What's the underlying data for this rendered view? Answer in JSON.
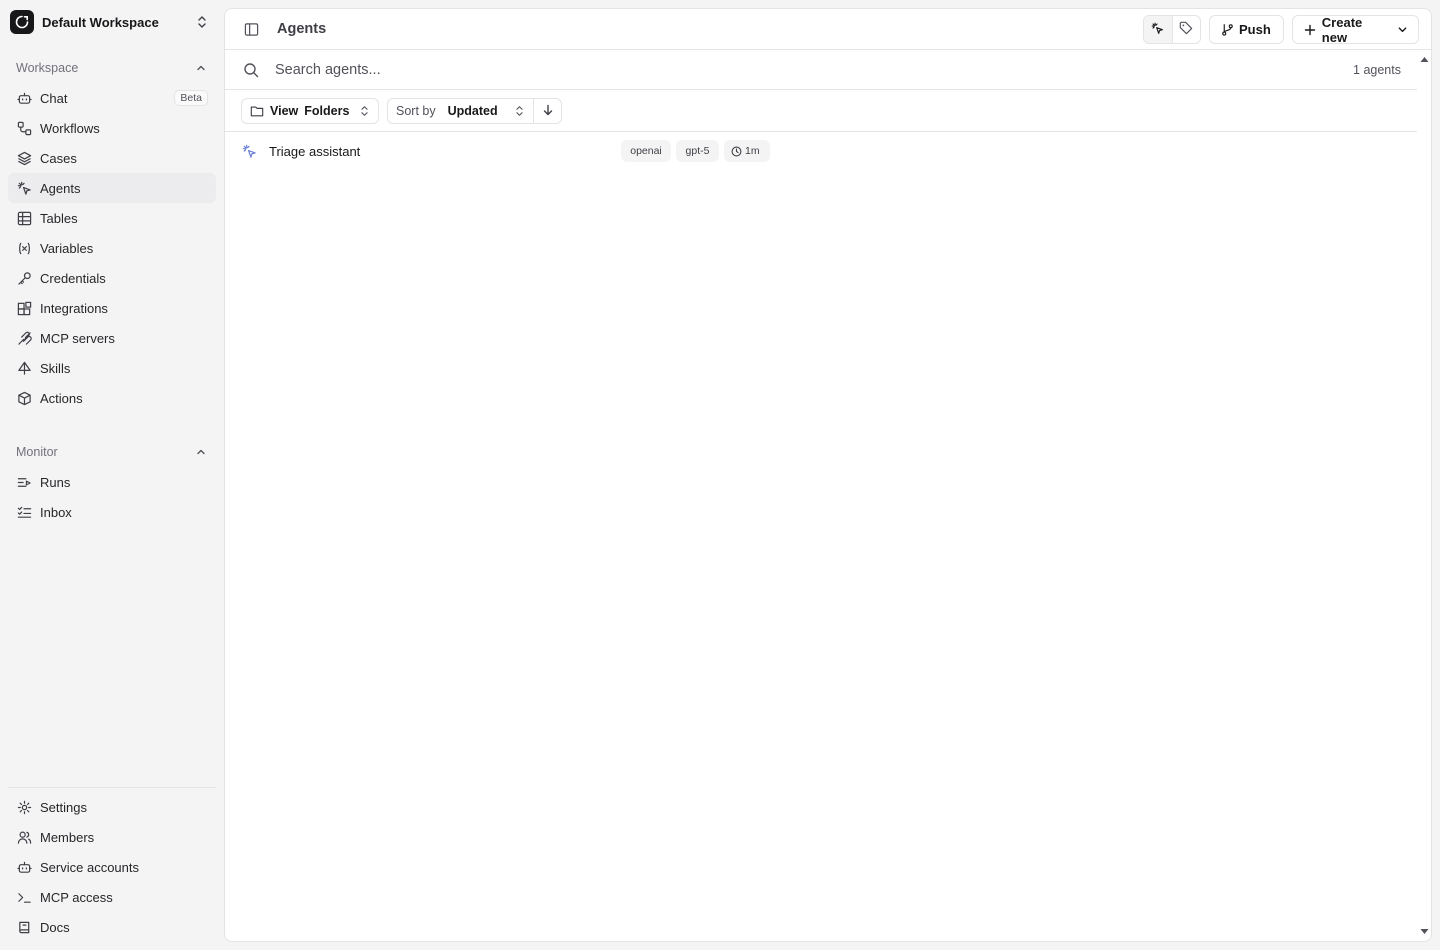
{
  "workspace": {
    "name": "Default Workspace"
  },
  "sidebar": {
    "workspace_section": {
      "label": "Workspace"
    },
    "workspace_items": [
      {
        "label": "Chat",
        "badge": "Beta"
      },
      {
        "label": "Workflows"
      },
      {
        "label": "Cases"
      },
      {
        "label": "Agents",
        "active": true
      },
      {
        "label": "Tables"
      },
      {
        "label": "Variables"
      },
      {
        "label": "Credentials"
      },
      {
        "label": "Integrations"
      },
      {
        "label": "MCP servers"
      },
      {
        "label": "Skills"
      },
      {
        "label": "Actions"
      }
    ],
    "monitor_section": {
      "label": "Monitor"
    },
    "monitor_items": [
      {
        "label": "Runs"
      },
      {
        "label": "Inbox"
      }
    ],
    "bottom_items": [
      {
        "label": "Settings"
      },
      {
        "label": "Members"
      },
      {
        "label": "Service accounts"
      },
      {
        "label": "MCP access"
      },
      {
        "label": "Docs"
      }
    ]
  },
  "header": {
    "title": "Agents",
    "push_label": "Push",
    "create_label": "Create new"
  },
  "search": {
    "placeholder": "Search agents...",
    "value": "",
    "count_label": "1 agents"
  },
  "filters": {
    "view_key": "View",
    "view_value": "Folders",
    "sort_key": "Sort by",
    "sort_value": "Updated"
  },
  "agents": [
    {
      "name": "Triage assistant",
      "provider": "openai",
      "model": "gpt-5",
      "updated": "1m"
    }
  ],
  "colors": {
    "accent_icon": "#6b7fd7",
    "text": "#18181b",
    "muted": "#71717a",
    "border": "#e4e4e7"
  }
}
